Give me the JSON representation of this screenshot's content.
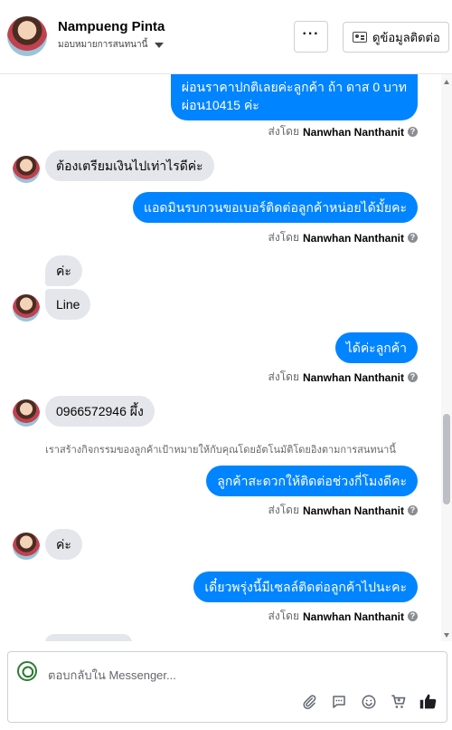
{
  "header": {
    "name": "Nampueng Pinta",
    "assign_label": "มอบหมายการสนทนานี้",
    "more_label": "···",
    "info_label": "ดูข้อมูลติดต่อ"
  },
  "messages": [
    {
      "dir": "out",
      "lines": [
        "ผ่อนราคาปกติเลยค่ะลูกค้า ถ้า ดาส 0 บาท",
        "ผ่อน10415 ค่ะ"
      ]
    },
    {
      "dir": "sent",
      "prefix": "ส่งโดย",
      "by": "Nanwhan Nanthanit"
    },
    {
      "dir": "in",
      "text": "ต้องเตรียมเงินไปเท่าไรดีค่ะ"
    },
    {
      "dir": "out",
      "text": "แอดมินรบกวนขอเบอร์ติดต่อลูกค้าหน่อยได้มั้ยคะ"
    },
    {
      "dir": "sent",
      "prefix": "ส่งโดย",
      "by": "Nanwhan Nanthanit"
    },
    {
      "dir": "in",
      "text": "ค่ะ"
    },
    {
      "dir": "in",
      "text": "Line"
    },
    {
      "dir": "out",
      "text": "ได้ค่ะลูกค้า"
    },
    {
      "dir": "sent",
      "prefix": "ส่งโดย",
      "by": "Nanwhan Nanthanit"
    },
    {
      "dir": "in",
      "text": "0966572946 ผึ้ง"
    },
    {
      "dir": "notice",
      "text": "เราสร้างกิจกรรมของลูกค้าเป้าหมายให้กับคุณโดยอัตโนมัติโดยอิงตามการสนทนานี้"
    },
    {
      "dir": "out",
      "text": "ลูกค้าสะดวกให้ติดต่อช่วงกี่โมงดีคะ"
    },
    {
      "dir": "sent",
      "prefix": "ส่งโดย",
      "by": "Nanwhan Nanthanit"
    },
    {
      "dir": "in",
      "text": "ค่ะ"
    },
    {
      "dir": "out",
      "text": "เดี๋ยวพรุ่งนี้มีเซลล์ติดต่อลูกค้าไปนะคะ"
    },
    {
      "dir": "sent",
      "prefix": "ส่งโดย",
      "by": "Nanwhan Nanthanit"
    }
  ],
  "composer": {
    "placeholder": "ตอบกลับใน Messenger...",
    "tools": [
      "attach-icon",
      "saved-reply-icon",
      "emoji-icon",
      "cart-icon",
      "like-icon"
    ]
  },
  "colors": {
    "outgoing_bubble": "#0084ff",
    "incoming_bubble": "#e4e6eb",
    "accent": "#0084ff"
  }
}
